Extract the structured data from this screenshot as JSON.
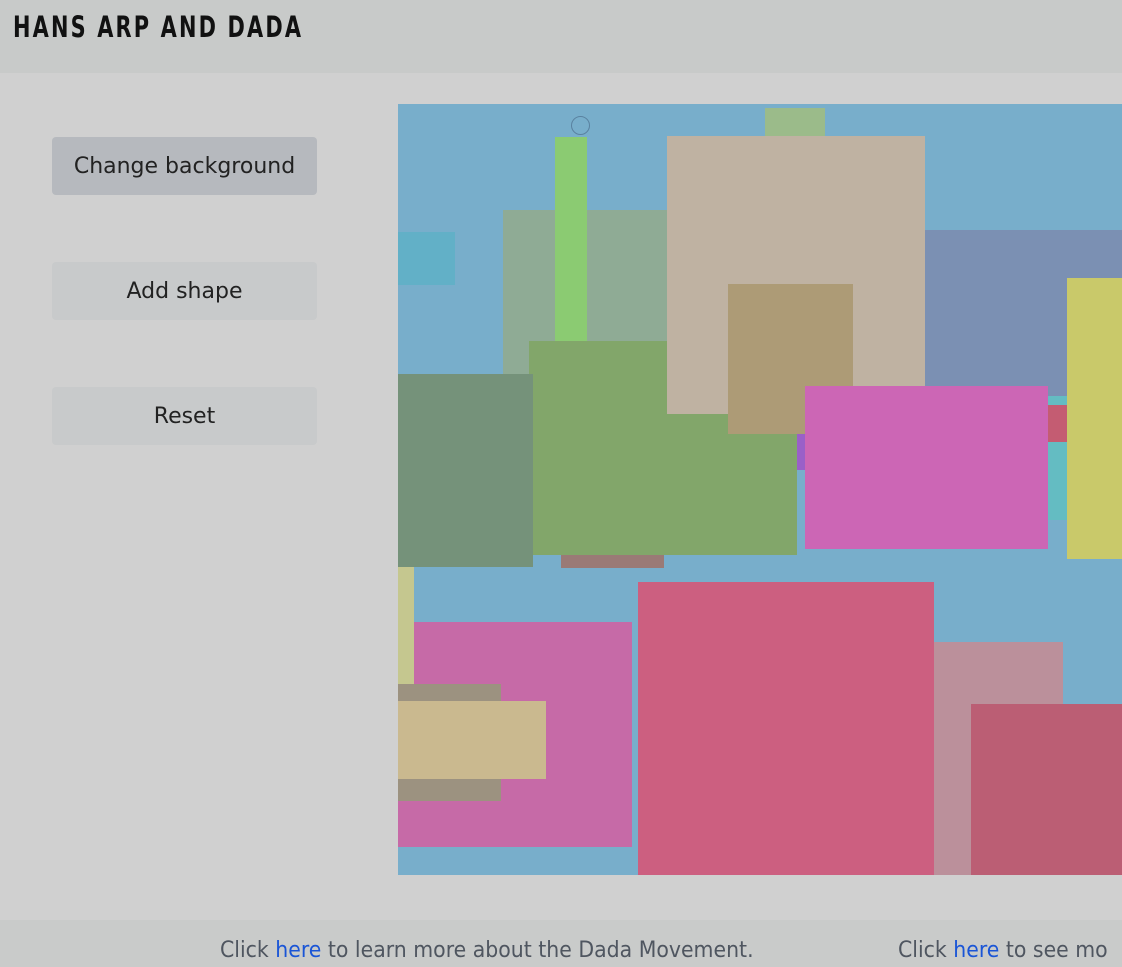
{
  "header": {
    "title": "HANS ARP AND DADA"
  },
  "controls": {
    "change_background": "Change background",
    "add_shape": "Add shape",
    "reset": "Reset"
  },
  "canvas": {
    "background": "#78aecb",
    "shape_colors": [
      "#62b0c7",
      "#9bbb8a",
      "#8fab95",
      "#8bcb72",
      "#7b90b3",
      "#64bcc2",
      "#c45c72",
      "#9a60c8",
      "#9a7a76",
      "#82a66a",
      "#75927a",
      "#bfb2a2",
      "#ad9b76",
      "#cc66b5",
      "#c9c96a",
      "#c66aa7",
      "#c5c78f",
      "#9c9280",
      "#cab98f",
      "#cc5f80",
      "#bb909b",
      "#bb5e74"
    ]
  },
  "footer": {
    "line1": {
      "pre": "Click ",
      "link": "here",
      "post": " to learn more about the Dada Movement."
    },
    "line2": {
      "pre": "Click ",
      "link": "here",
      "post": " to see mo"
    }
  }
}
